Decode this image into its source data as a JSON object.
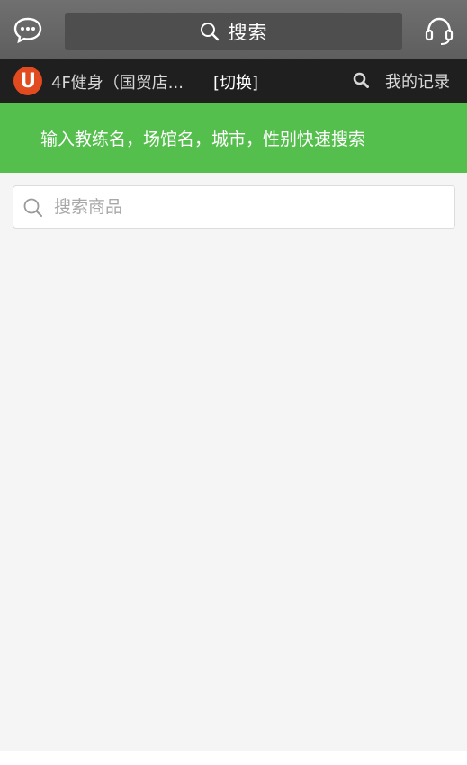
{
  "topbar": {
    "search_label": "搜索",
    "chat_icon": "chat-bubble-icon",
    "headset_icon": "headset-icon"
  },
  "storebar": {
    "logo_letter": "U",
    "store_name": "4F健身（国贸店...",
    "switch_label": "[切换]",
    "records_label": "我的记录"
  },
  "hint": {
    "text": "输入教练名，场馆名，城市，性别快速搜索"
  },
  "product_search": {
    "placeholder": "搜索商品",
    "value": ""
  },
  "colors": {
    "topbar": "#666666",
    "storebar": "#1f1f1f",
    "banner": "#55bf4d",
    "logo": "#e24a1f",
    "background": "#f5f5f5"
  }
}
